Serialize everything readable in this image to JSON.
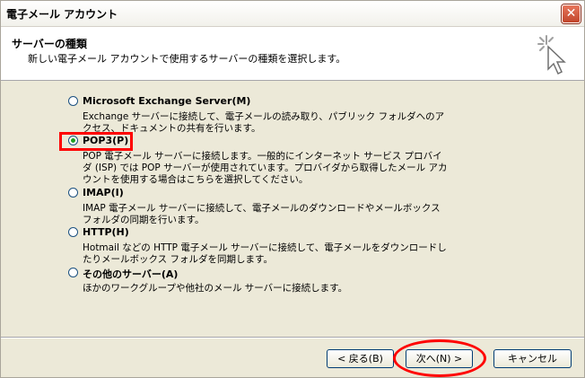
{
  "window": {
    "title": "電子メール アカウント",
    "close_glyph": "✕"
  },
  "header": {
    "title": "サーバーの種類",
    "subtitle": "新しい電子メール アカウントで使用するサーバーの種類を選択します。"
  },
  "options": [
    {
      "label": "Microsoft Exchange Server(M)",
      "desc": "Exchange サーバーに接続して、電子メールの読み取り、パブリック フォルダへのアクセス、ドキュメントの共有を行います。",
      "checked": false
    },
    {
      "label": "POP3(P)",
      "desc": "POP 電子メール サーバーに接続します。一般的にインターネット サービス プロバイダ (ISP) では POP サーバーが使用されています。プロバイダから取得したメール アカウントを使用する場合はこちらを選択してください。",
      "checked": true
    },
    {
      "label": "IMAP(I)",
      "desc": "IMAP 電子メール サーバーに接続して、電子メールのダウンロードやメールボックス フォルダの同期を行います。",
      "checked": false
    },
    {
      "label": "HTTP(H)",
      "desc": "Hotmail などの HTTP 電子メール サーバーに接続して、電子メールをダウンロードしたりメールボックス フォルダを同期します。",
      "checked": false
    },
    {
      "label": "その他のサーバー(A)",
      "desc": "ほかのワークグループや他社のメール サーバーに接続します。",
      "checked": false
    }
  ],
  "buttons": {
    "back": "< 戻る(B)",
    "next": "次へ(N) >",
    "cancel": "キャンセル"
  },
  "colors": {
    "annotation": "#ff0000",
    "radio_checked": "#21a121"
  },
  "icons": {
    "header": "wizard-sparkle-cursor-icon"
  }
}
